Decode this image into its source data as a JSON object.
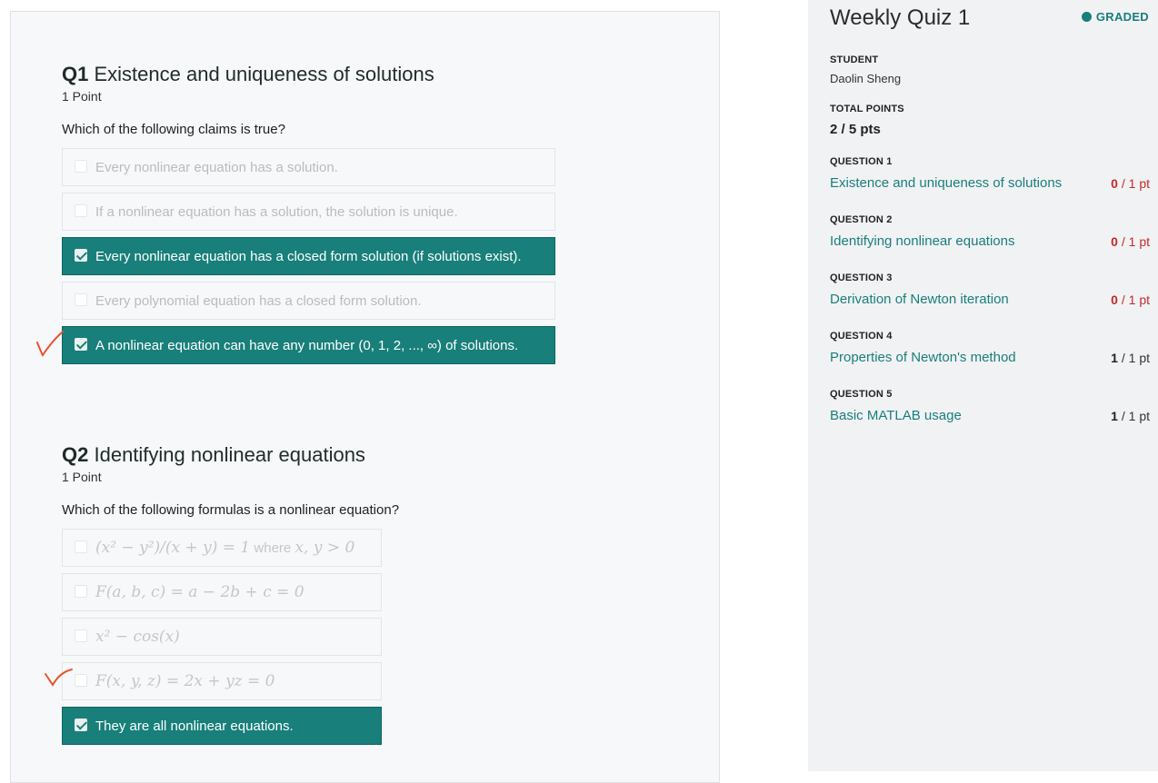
{
  "quiz": {
    "title": "Weekly Quiz 1",
    "status": "GRADED",
    "student_label": "STUDENT",
    "student_name": "Daolin Sheng",
    "total_label": "TOTAL POINTS",
    "total_value": "2 / 5 pts"
  },
  "questions": [
    {
      "number": "Q1",
      "title": "Existence and uniqueness of solutions",
      "points": "1 Point",
      "prompt": "Which of the following claims is true?",
      "options": [
        {
          "text": "Every nonlinear equation has a solution.",
          "selected": false
        },
        {
          "text": "If a nonlinear equation has a solution, the solution is unique.",
          "selected": false
        },
        {
          "text": "Every nonlinear equation has a closed form solution (if solutions exist).",
          "selected": true
        },
        {
          "text": "Every polynomial equation has a closed form solution.",
          "selected": false
        },
        {
          "text": "A nonlinear equation can have any number (0, 1, 2, ..., ∞) of solutions.",
          "selected": true
        }
      ]
    },
    {
      "number": "Q2",
      "title": "Identifying nonlinear equations",
      "points": "1 Point",
      "prompt": "Which of the following formulas is a nonlinear equation?",
      "options": [
        {
          "math": "(x² − y²)/(x + y) = 1",
          "text": " where ",
          "math2": "x, y > 0",
          "selected": false
        },
        {
          "math": "F(a, b, c) = a − 2b + c = 0",
          "selected": false
        },
        {
          "math": "x² − cos(x)",
          "selected": false
        },
        {
          "math": "F(x, y, z) = 2x + yz = 0",
          "selected": false
        },
        {
          "text": "They are all nonlinear equations.",
          "selected": true
        }
      ]
    }
  ],
  "sidebar": {
    "items": [
      {
        "label": "QUESTION 1",
        "title": "Existence and uniqueness of solutions",
        "got": "0",
        "max": " / 1 pt"
      },
      {
        "label": "QUESTION 2",
        "title": "Identifying nonlinear equations",
        "got": "0",
        "max": " / 1 pt"
      },
      {
        "label": "QUESTION 3",
        "title": "Derivation of Newton iteration",
        "got": "0",
        "max": " / 1 pt"
      },
      {
        "label": "QUESTION 4",
        "title": "Properties of Newton's method",
        "got": "1",
        "max": " / 1 pt"
      },
      {
        "label": "QUESTION 5",
        "title": "Basic MATLAB usage",
        "got": "1",
        "max": " / 1 pt"
      }
    ]
  },
  "colors": {
    "accent": "#187f7a",
    "wrong": "#c62828",
    "annotation": "#e8542b"
  },
  "icons": [
    "checkbox-icon",
    "checkmark-annotation-icon",
    "status-dot-icon"
  ]
}
